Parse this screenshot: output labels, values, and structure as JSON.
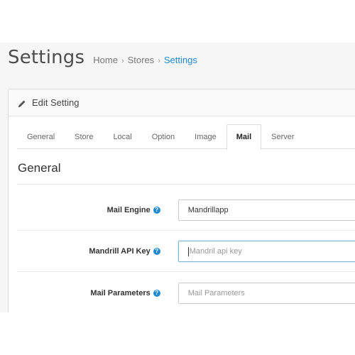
{
  "header": {
    "title": "Settings",
    "breadcrumb": [
      "Home",
      "Stores",
      "Settings"
    ]
  },
  "panel": {
    "title": "Edit Setting",
    "icon": "pencil-icon"
  },
  "tabs": [
    "General",
    "Store",
    "Local",
    "Option",
    "Image",
    "Mail",
    "Server"
  ],
  "active_tab": "Mail",
  "section": {
    "legend": "General"
  },
  "fields": [
    {
      "label": "Mail Engine",
      "value": "Mandrillapp",
      "placeholder": ""
    },
    {
      "label": "Mandrill API Key",
      "value": "",
      "placeholder": "Mandril api key"
    },
    {
      "label": "Mail Parameters",
      "value": "",
      "placeholder": "Mail Parameters"
    }
  ],
  "colors": {
    "accent": "#1f8ad2",
    "page_bg": "#f6f6f6"
  }
}
